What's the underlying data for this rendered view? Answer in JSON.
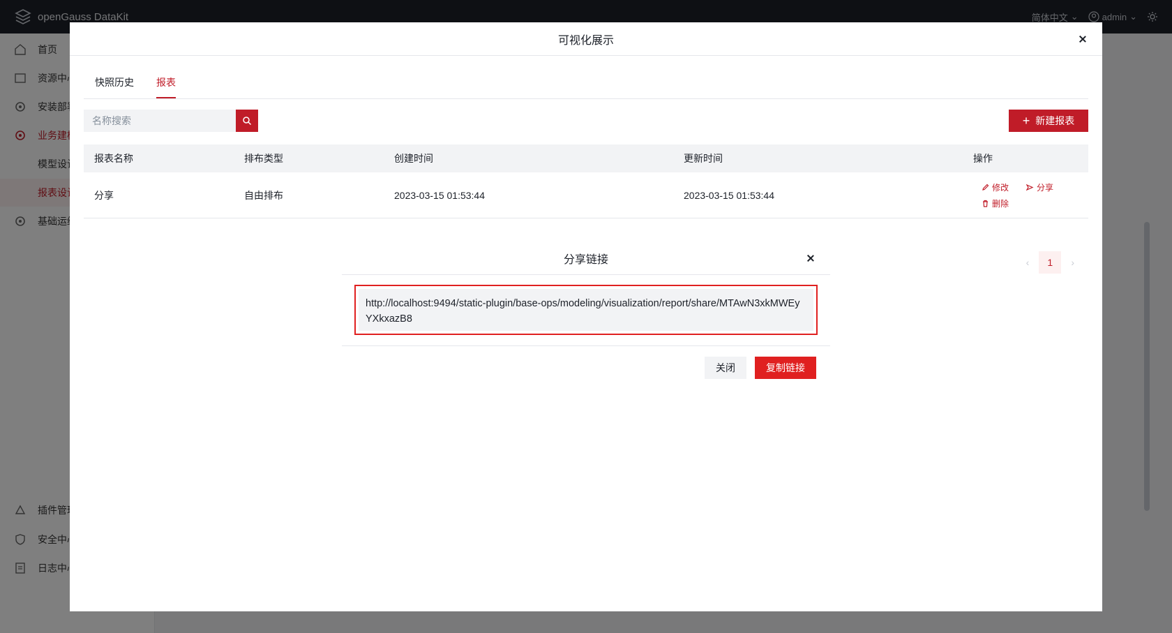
{
  "app": {
    "brand": "openGauss DataKit",
    "language": "简体中文",
    "user": "admin"
  },
  "sidebar": {
    "items": [
      {
        "label": "首页",
        "icon": "home-icon"
      },
      {
        "label": "资源中心",
        "icon": "resource-icon"
      },
      {
        "label": "安装部署",
        "icon": "install-icon"
      },
      {
        "label": "业务建模",
        "icon": "modeling-icon"
      },
      {
        "label": "模型设计",
        "icon": ""
      },
      {
        "label": "报表设计",
        "icon": ""
      },
      {
        "label": "基础运维",
        "icon": "ops-icon"
      },
      {
        "label": "插件管理",
        "icon": "plugin-icon"
      },
      {
        "label": "安全中心",
        "icon": "security-icon"
      },
      {
        "label": "日志中心",
        "icon": "log-icon"
      }
    ]
  },
  "dialog": {
    "title": "可视化展示",
    "tabs": [
      {
        "label": "快照历史",
        "active": false
      },
      {
        "label": "报表",
        "active": true
      }
    ],
    "search_placeholder": "名称搜索",
    "new_button": "新建报表",
    "table": {
      "headers": [
        "报表名称",
        "排布类型",
        "创建时间",
        "更新时间",
        "操作"
      ],
      "rows": [
        {
          "name": "分享",
          "layout": "自由排布",
          "created": "2023-03-15 01:53:44",
          "updated": "2023-03-15 01:53:44",
          "actions": {
            "edit": "修改",
            "share": "分享",
            "delete": "删除"
          }
        }
      ]
    },
    "pagination": {
      "current": "1"
    }
  },
  "share_modal": {
    "title": "分享链接",
    "url": "http://localhost:9494/static-plugin/base-ops/modeling/visualization/report/share/MTAwN3xkMWEyYXkxazB8",
    "close_button": "关闭",
    "copy_button": "复制链接"
  },
  "colors": {
    "accent": "#c01c28",
    "highlight_border": "#e02020",
    "topbar": "#1d2129"
  }
}
